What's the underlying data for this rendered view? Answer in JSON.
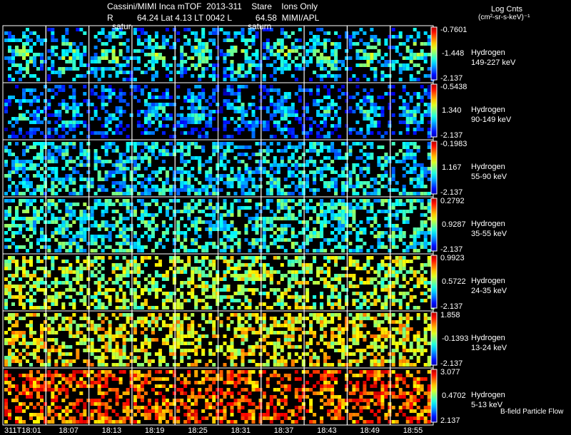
{
  "title": {
    "line1": "Cassini/MIMI Inca mTOF  2013-311    Stare    Ions Only",
    "line2": "R          64.24 Lat 4.13 LT 0042 L          64.58  MIMI/APL",
    "planet_label_1": "satur",
    "planet_label_2": "saturn"
  },
  "colorbar_title": {
    "line1": "Log Cnts",
    "line2": "(cm²-sr-s-keV)⁻¹"
  },
  "footer_label": "B-field Particle Flow",
  "chart_data": {
    "type": "heatmap",
    "colormap": "jet",
    "grid": {
      "rows": 7,
      "columns": 10
    },
    "time_labels": [
      "311T18:01",
      "18:07",
      "18:13",
      "18:19",
      "18:25",
      "18:31",
      "18:37",
      "18:43",
      "18:49",
      "18:55"
    ],
    "rows": [
      {
        "species": "Hydrogen",
        "energy": "149-227 keV",
        "cbar_max": "-0.7601",
        "cbar_mid": "-1.448",
        "cbar_min": "-2.137",
        "dominant_color": "#3060ff"
      },
      {
        "species": "Hydrogen",
        "energy": "90-149 keV",
        "cbar_max": "-0.5438",
        "cbar_mid": "1.340",
        "cbar_min": "-2.137",
        "dominant_color": "#1030e0"
      },
      {
        "species": "Hydrogen",
        "energy": "55-90 keV",
        "cbar_max": "-0.1983",
        "cbar_mid": "1.167",
        "cbar_min": "-2.137",
        "dominant_color": "#20c0ff"
      },
      {
        "species": "Hydrogen",
        "energy": "35-55 keV",
        "cbar_max": "0.2792",
        "cbar_mid": "0.9287",
        "cbar_min": "-2.137",
        "dominant_color": "#30e0e0"
      },
      {
        "species": "Hydrogen",
        "energy": "24-35 keV",
        "cbar_max": "0.9923",
        "cbar_mid": "0.5722",
        "cbar_min": "-2.137",
        "dominant_color": "#80ff80"
      },
      {
        "species": "Hydrogen",
        "energy": "13-24 keV",
        "cbar_max": "1.858",
        "cbar_mid": "-0.1393",
        "cbar_min": "-2.137",
        "dominant_color": "#c0ff40"
      },
      {
        "species": "Hydrogen",
        "energy": "5-13 keV",
        "cbar_max": "3.077",
        "cbar_mid": "0.4702",
        "cbar_min": "2.137",
        "dominant_color": "#ffb000"
      }
    ]
  }
}
